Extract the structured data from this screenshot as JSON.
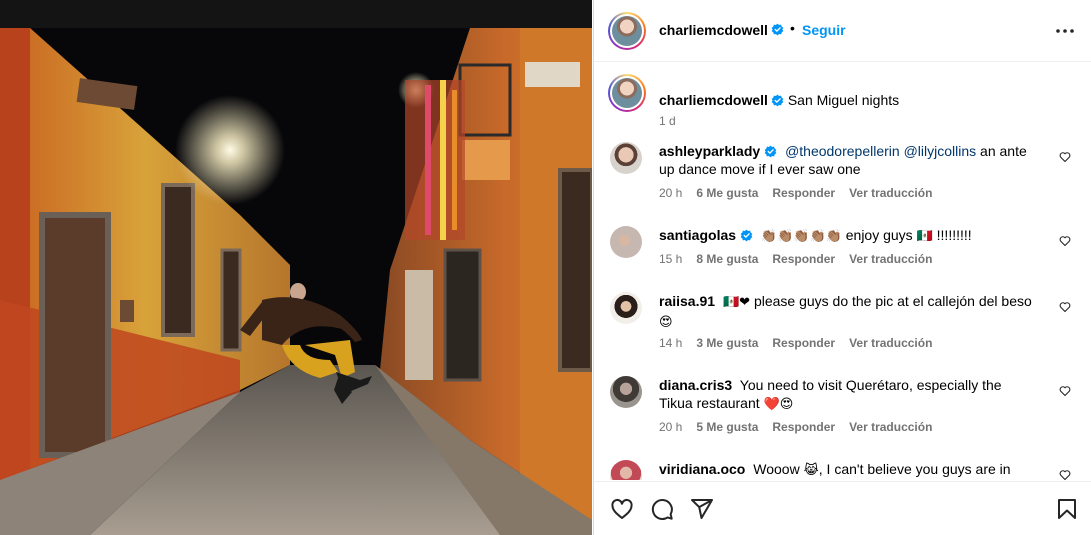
{
  "post": {
    "author": "charliemcdowell",
    "follow_label": "Seguir",
    "separator": "•",
    "caption": "San Miguel nights",
    "caption_time": "1 d"
  },
  "labels": {
    "reply": "Responder",
    "translate": "Ver traducción"
  },
  "comments": [
    {
      "username": "ashleyparklady",
      "verified": true,
      "mention1": "@theodorepellerin",
      "mention2": "@lilyjcollins",
      "text": "an ante up dance move if I ever saw one",
      "time": "20 h",
      "likes": "6 Me gusta"
    },
    {
      "username": "santiagolas",
      "verified": true,
      "emoji": "👏🏽👏🏽👏🏽👏🏽👏🏽",
      "text": "enjoy guys",
      "flag": "🇲🇽",
      "tail": "!!!!!!!!!",
      "time": "15 h",
      "likes": "8 Me gusta"
    },
    {
      "username": "raiisa.91",
      "flag": "🇲🇽",
      "heart": "❤",
      "text": "please guys do the pic at el callejón del beso",
      "emoji": "😍",
      "time": "14 h",
      "likes": "3 Me gusta"
    },
    {
      "username": "diana.cris3",
      "text": "You need to visit Querétaro, especially the Tikua restaurant",
      "emoji_heart": "❤️",
      "emoji": "😍",
      "time": "20 h",
      "likes": "5 Me gusta"
    },
    {
      "username": "viridiana.oco",
      "text": "Wooow",
      "emoji": "😹",
      "text2": ", I can't believe you guys are in"
    }
  ],
  "icons": {
    "verified": "verified-badge-icon",
    "more": "more-options-icon",
    "like": "heart-icon",
    "comment": "comment-icon",
    "share": "share-icon",
    "save": "bookmark-icon"
  },
  "colors": {
    "link": "#0095f6",
    "verified": "#0095f6",
    "muted": "#737373",
    "mention": "#00376b"
  }
}
